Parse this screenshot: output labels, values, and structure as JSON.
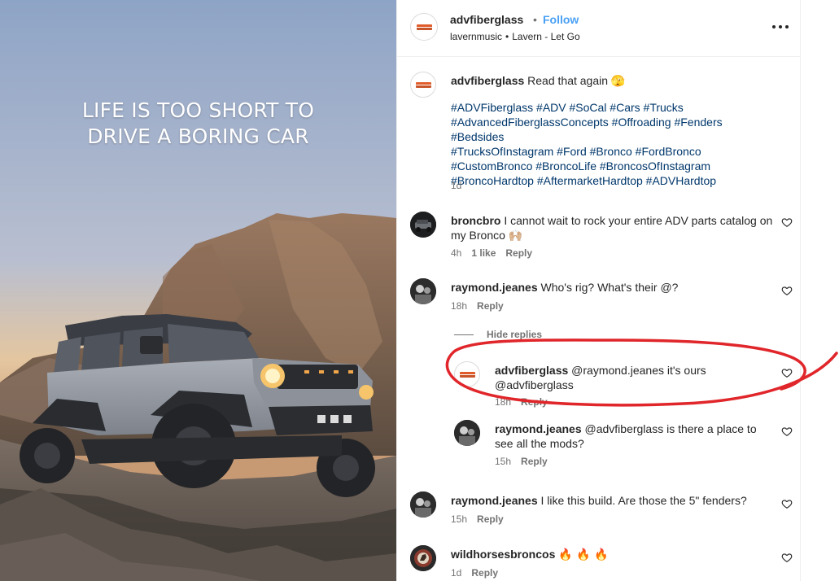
{
  "post": {
    "overlay_line1": "LIFE IS TOO SHORT TO",
    "overlay_line2": "DRIVE A BORING CAR"
  },
  "header": {
    "username": "advfiberglass",
    "separator": "•",
    "follow_label": "Follow",
    "audio_artist": "lavernmusic",
    "audio_separator": "•",
    "audio_track": "Lavern - Let Go"
  },
  "caption": {
    "username": "advfiberglass",
    "text": "Read that again",
    "emoji": "🫣",
    "hashtags_line1": "#ADVFiberglass #ADV #SoCal #Cars #Trucks",
    "hashtags_line2": "#AdvancedFiberglassConcepts #Offroading #Fenders #Bedsides",
    "hashtags_line3": "#TrucksOfInstagram #Ford #Bronco #FordBronco",
    "hashtags_line4": "#CustomBronco #BroncoLife #BroncosOfInstagram",
    "hashtags_line5": "#BroncoHardtop #AftermarketHardtop #ADVHardtop",
    "time": "1d"
  },
  "comments": [
    {
      "username": "broncbro",
      "text": "I cannot wait to rock your entire ADV parts catalog on my Bronco",
      "emoji": "🙌🏼",
      "time": "4h",
      "likes": "1 like",
      "reply_label": "Reply"
    },
    {
      "username": "raymond.jeanes",
      "text": "Who's rig? What's their @?",
      "time": "18h",
      "reply_label": "Reply",
      "hide_replies_label": "Hide replies",
      "replies": [
        {
          "username": "advfiberglass",
          "text": "@raymond.jeanes it's ours @advfiberglass",
          "time": "18h",
          "reply_label": "Reply"
        },
        {
          "username": "raymond.jeanes",
          "text": "@advfiberglass is there a place to see all the mods?",
          "time": "15h",
          "reply_label": "Reply"
        }
      ]
    },
    {
      "username": "raymond.jeanes",
      "text": "I like this build. Are those the 5\" fenders?",
      "time": "15h",
      "reply_label": "Reply"
    },
    {
      "username": "wildhorsesbroncos",
      "emoji": "🔥 🔥 🔥",
      "time": "1d",
      "reply_label": "Reply"
    }
  ],
  "icons": {
    "more": "more-options-icon",
    "heart": "heart-outline-icon"
  },
  "colors": {
    "follow": "#4aa0f5",
    "hashtag": "#00376b",
    "annotation_circle": "#e0262a"
  }
}
